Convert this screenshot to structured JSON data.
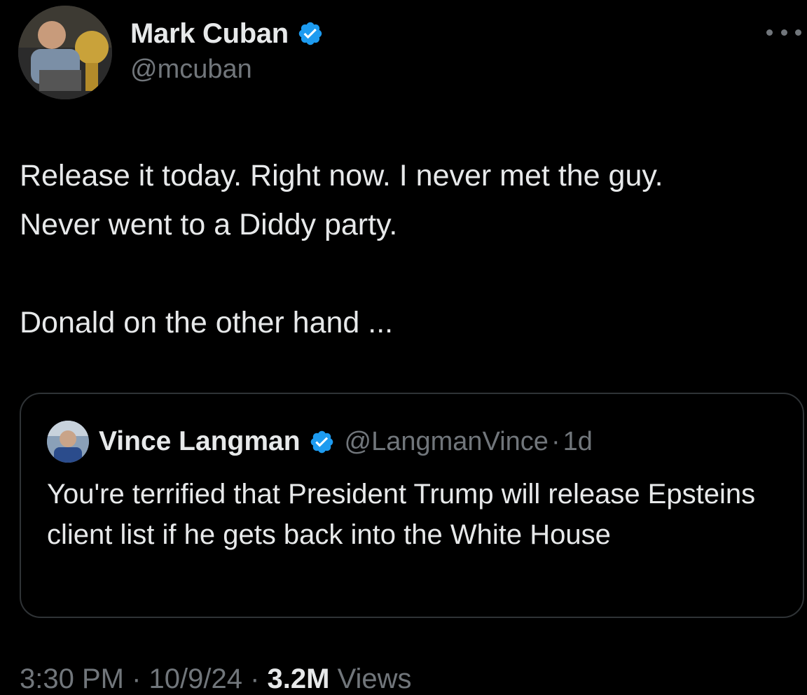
{
  "tweet": {
    "author": {
      "display_name": "Mark Cuban",
      "handle": "@mcuban",
      "verified_icon": "verified-badge-icon"
    },
    "more_icon": "more-options-icon",
    "text": {
      "line1": "Release it today. Right now. I never met the guy.",
      "line2": "Never went to a Diddy party.",
      "line3": "Donald on the other hand ..."
    },
    "quote": {
      "display_name": "Vince Langman",
      "handle": "@LangmanVince",
      "separator": "·",
      "time": "1d",
      "text": "You're terrified that President Trump will release Epsteins client list if he gets back into the White House"
    },
    "meta": {
      "time": "3:30 PM · 10/9/24 · ",
      "views": "3.2M",
      "views_label": " Views"
    }
  },
  "colors": {
    "background": "#000000",
    "primary_text": "#e7e9ea",
    "secondary_text": "#71767b",
    "border": "#2f3336",
    "verified_blue": "#1d9bf0"
  }
}
